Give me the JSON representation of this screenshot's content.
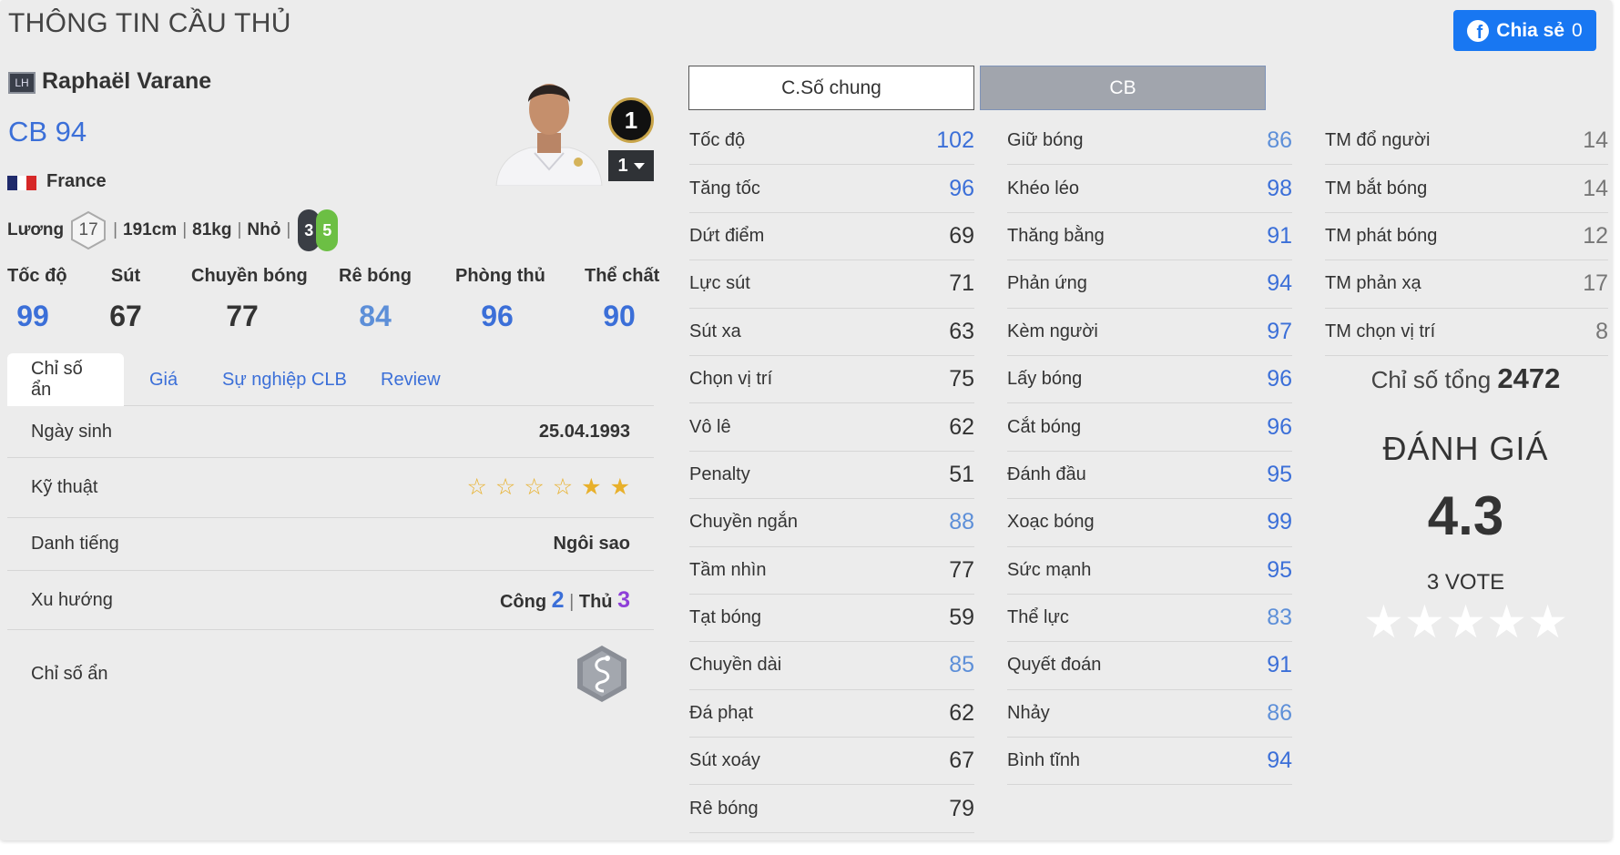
{
  "header": {
    "title": "THÔNG TIN CẦU THỦ",
    "share_label": "Chia sẻ",
    "share_count": "0"
  },
  "player": {
    "season_badge": "LH",
    "name": "Raphaël Varane",
    "position_ovr": "CB 94",
    "nation": "France",
    "salary_label": "Lương",
    "salary": "17",
    "height": "191cm",
    "weight": "81kg",
    "body": "Nhỏ",
    "weak_foot": "3",
    "strong_foot": "5",
    "rank": "1",
    "upgrade_level": "1",
    "flag_colors": [
      "#1f2a6b",
      "#ffffff",
      "#d62828"
    ]
  },
  "main_stats": [
    {
      "label": "Tốc độ",
      "value": "99",
      "color": "#3b6fd8"
    },
    {
      "label": "Sút",
      "value": "67",
      "color": "#333333"
    },
    {
      "label": "Chuyền bóng",
      "value": "77",
      "color": "#333333"
    },
    {
      "label": "Rê bóng",
      "value": "84",
      "color": "#5d8fd8"
    },
    {
      "label": "Phòng thủ",
      "value": "96",
      "color": "#3b6fd8"
    },
    {
      "label": "Thể chất",
      "value": "90",
      "color": "#3b6fd8"
    }
  ],
  "tabs": [
    "Chỉ số ẩn",
    "Giá",
    "Sự nghiệp CLB",
    "Review"
  ],
  "info": {
    "birth_label": "Ngày sinh",
    "birth_value": "25.04.1993",
    "skill_label": "Kỹ thuật",
    "skill_stars": 2,
    "skill_stars_max": 6,
    "fame_label": "Danh tiếng",
    "fame_value": "Ngôi sao",
    "trend_label": "Xu hướng",
    "trend_att_label": "Công",
    "trend_att": "2",
    "trend_def_label": "Thủ",
    "trend_def": "3",
    "hidden_label": "Chỉ số ẩn"
  },
  "stat_tabs": {
    "general": "C.Số chung",
    "position": "CB"
  },
  "columns": [
    [
      {
        "name": "Tốc độ",
        "value": "102",
        "tone": "blue"
      },
      {
        "name": "Tăng tốc",
        "value": "96",
        "tone": "blue"
      },
      {
        "name": "Dứt điểm",
        "value": "69",
        "tone": "dark"
      },
      {
        "name": "Lực sút",
        "value": "71",
        "tone": "dark"
      },
      {
        "name": "Sút xa",
        "value": "63",
        "tone": "dark"
      },
      {
        "name": "Chọn vị trí",
        "value": "75",
        "tone": "dark"
      },
      {
        "name": "Vô lê",
        "value": "62",
        "tone": "dark"
      },
      {
        "name": "Penalty",
        "value": "51",
        "tone": "dark"
      },
      {
        "name": "Chuyền ngắn",
        "value": "88",
        "tone": "lblue"
      },
      {
        "name": "Tầm nhìn",
        "value": "77",
        "tone": "dark"
      },
      {
        "name": "Tạt bóng",
        "value": "59",
        "tone": "dark"
      },
      {
        "name": "Chuyền dài",
        "value": "85",
        "tone": "lblue"
      },
      {
        "name": "Đá phạt",
        "value": "62",
        "tone": "dark"
      },
      {
        "name": "Sút xoáy",
        "value": "67",
        "tone": "dark"
      },
      {
        "name": "Rê bóng",
        "value": "79",
        "tone": "dark"
      }
    ],
    [
      {
        "name": "Giữ bóng",
        "value": "86",
        "tone": "lblue"
      },
      {
        "name": "Khéo léo",
        "value": "98",
        "tone": "blue"
      },
      {
        "name": "Thăng bằng",
        "value": "91",
        "tone": "blue"
      },
      {
        "name": "Phản ứng",
        "value": "94",
        "tone": "blue"
      },
      {
        "name": "Kèm người",
        "value": "97",
        "tone": "blue"
      },
      {
        "name": "Lấy bóng",
        "value": "96",
        "tone": "blue"
      },
      {
        "name": "Cắt bóng",
        "value": "96",
        "tone": "blue"
      },
      {
        "name": "Đánh đầu",
        "value": "95",
        "tone": "blue"
      },
      {
        "name": "Xoạc bóng",
        "value": "99",
        "tone": "blue"
      },
      {
        "name": "Sức mạnh",
        "value": "95",
        "tone": "blue"
      },
      {
        "name": "Thể lực",
        "value": "83",
        "tone": "lblue"
      },
      {
        "name": "Quyết đoán",
        "value": "91",
        "tone": "blue"
      },
      {
        "name": "Nhảy",
        "value": "86",
        "tone": "lblue"
      },
      {
        "name": "Bình tĩnh",
        "value": "94",
        "tone": "blue"
      }
    ],
    [
      {
        "name": "TM đổ người",
        "value": "14",
        "tone": "gray"
      },
      {
        "name": "TM bắt bóng",
        "value": "14",
        "tone": "gray"
      },
      {
        "name": "TM phát bóng",
        "value": "12",
        "tone": "gray"
      },
      {
        "name": "TM phản xạ",
        "value": "17",
        "tone": "gray"
      },
      {
        "name": "TM chọn vị trí",
        "value": "8",
        "tone": "gray"
      }
    ]
  ],
  "summary": {
    "total_label": "Chỉ số tổng",
    "total_value": "2472",
    "rating_title": "ĐÁNH GIÁ",
    "rating_score": "4.3",
    "votes": "3 VOTE",
    "star_count": 5
  }
}
